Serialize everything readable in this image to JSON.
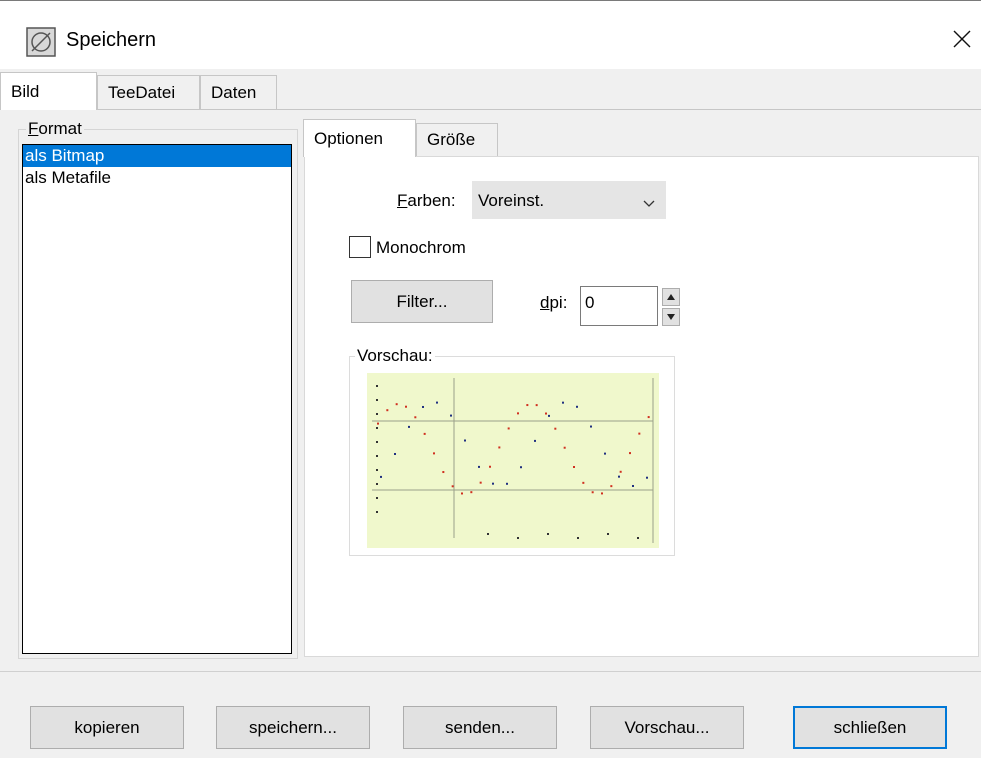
{
  "window": {
    "title": "Speichern"
  },
  "tabs": [
    {
      "label": "Bild",
      "active": true
    },
    {
      "label": "TeeDatei",
      "active": false
    },
    {
      "label": "Daten",
      "active": false
    }
  ],
  "format_group": {
    "legend_first": "F",
    "legend_rest": "ormat",
    "items": [
      {
        "label": "als Bitmap",
        "selected": true
      },
      {
        "label": "als Metafile",
        "selected": false
      }
    ]
  },
  "options_tabs": [
    {
      "label": "Optionen",
      "active": true
    },
    {
      "label": "Größe",
      "active": false
    }
  ],
  "options": {
    "colors_label_first": "F",
    "colors_label_rest": "arben:",
    "colors_value": "Voreinst.",
    "monochrome_label": "Monochrom",
    "monochrome_checked": false,
    "filter_button": "Filter...",
    "dpi_label_first": "d",
    "dpi_label_rest": "pi:",
    "dpi_value": "0",
    "preview_label": "Vorschau:"
  },
  "buttons": [
    "kopieren",
    "speichern...",
    "senden...",
    "Vorschau...",
    "schließen"
  ],
  "colors": {
    "selection": "#0078d7",
    "preview_background": "#f0f8cc",
    "series_red": "#d03020",
    "series_blue": "#203080"
  },
  "icons": {
    "app": "teechart-app-icon",
    "close": "close-icon",
    "dropdown": "chevron-down-icon",
    "spin_up": "arrow-up-icon",
    "spin_down": "arrow-down-icon"
  }
}
